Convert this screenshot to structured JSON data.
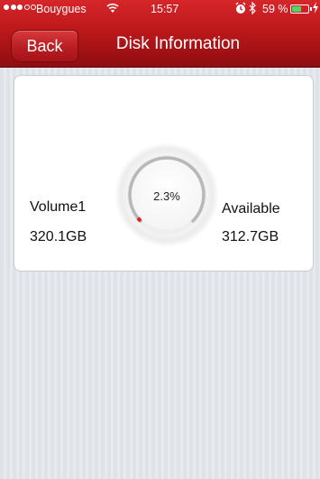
{
  "status_bar": {
    "carrier": "Bouygues",
    "time": "15:57",
    "battery_percent": "59 %",
    "battery_level": 0.59,
    "signal_bars_filled": 3,
    "signal_bars_total": 5,
    "wifi_icon": "wifi-icon",
    "alarm_icon": "alarm-icon",
    "bluetooth_icon": "bluetooth-icon",
    "charging_icon": "charging-bolt-icon"
  },
  "nav": {
    "back_label": "Back",
    "title": "Disk Information"
  },
  "disk": {
    "volume_name": "Volume1",
    "volume_size": "320.1GB",
    "used_percent_label": "2.3%",
    "used_fraction": 0.023,
    "available_label": "Available",
    "available_size": "312.7GB"
  },
  "colors": {
    "nav_red": "#bd181b",
    "gauge_used": "#e02020",
    "gauge_track": "#bfbfbf",
    "battery_green": "#4cd964"
  }
}
